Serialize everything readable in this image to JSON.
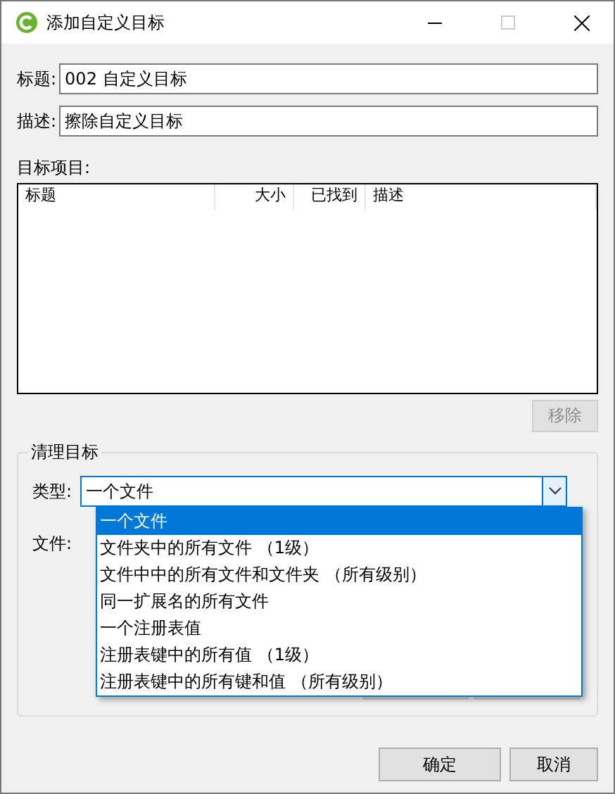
{
  "window": {
    "title": "添加自定义目标"
  },
  "fields": [
    {
      "label": "标题:",
      "value": "002 自定义目标"
    },
    {
      "label": "描述:",
      "value": "擦除自定义目标"
    }
  ],
  "items": {
    "label": "目标项目:",
    "columns": [
      {
        "label": "标题"
      },
      {
        "label": "大小"
      },
      {
        "label": "已找到"
      },
      {
        "label": "描述"
      }
    ],
    "remove_button": {
      "label": "移除",
      "disabled": true
    }
  },
  "cleanup": {
    "title": "清理目标",
    "type_label": "类型:",
    "type_value": "一个文件",
    "file_label": "文件:",
    "options": [
      {
        "label": "一个文件",
        "selected": true
      },
      {
        "label": "文件夹中的所有文件 （1级）",
        "selected": false
      },
      {
        "label": "文件中中的所有文件和文件夹 （所有级别）",
        "selected": false
      },
      {
        "label": "同一扩展名的所有文件",
        "selected": false
      },
      {
        "label": "一个注册表值",
        "selected": false
      },
      {
        "label": "注册表键中的所有值 （1级）",
        "selected": false
      },
      {
        "label": "注册表键中的所有键和值 （所有级别）",
        "selected": false
      }
    ]
  },
  "buttons": [
    {
      "label": "确定"
    },
    {
      "label": "取消"
    }
  ]
}
